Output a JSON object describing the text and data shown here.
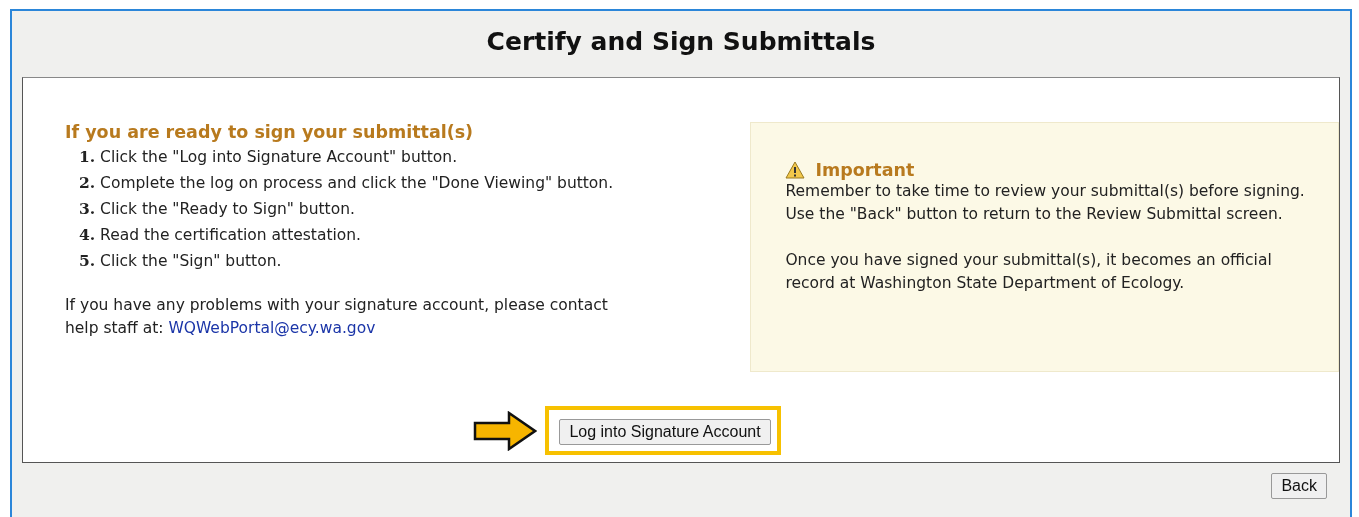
{
  "page": {
    "title": "Certify and Sign Submittals"
  },
  "instructions": {
    "heading": "If you are ready to sign your submittal(s)",
    "steps": [
      {
        "text": "**1.** Click the \"Log into Signature Account\" button."
      },
      {
        "text": "**2.** Complete the log on process and click the \"Done Viewing\" button."
      },
      {
        "text": "**3.** Click the \"Ready to Sign\" button."
      },
      {
        "text": "**4.** Read the certification attestation."
      },
      {
        "text": "**5.** Click the \"Sign\" button."
      }
    ],
    "help_text": "If you have any problems with your signature account, please contact help staff at: ",
    "help_link": "WQWebPortal@ecy.wa.gov"
  },
  "notice": {
    "title": "Important",
    "paragraphs": [
      "Remember to take time to review your submittal(s) before signing. Use the \"Back\" button to return to the Review Submittal screen.",
      "Once you have signed your submittal(s), it becomes an official record at Washington State Department of Ecology."
    ]
  },
  "login_button": {
    "label": "Log into Signature Account",
    "highlighted": true
  },
  "back_button": {
    "label": "Back"
  }
}
